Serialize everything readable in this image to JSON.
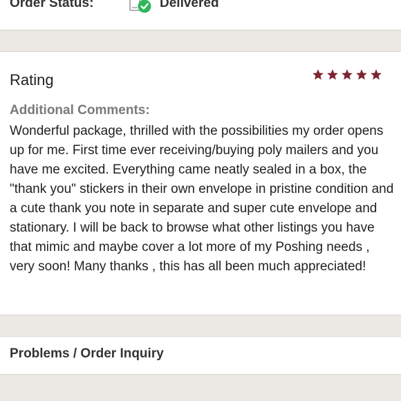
{
  "order_status": {
    "label": "Order Status:",
    "value": "Delivered",
    "icon": "package-delivered-check-icon",
    "check_color": "#2fb65a"
  },
  "rating": {
    "title": "Rating",
    "stars": 5,
    "max_stars": 5,
    "star_color": "#7d2630",
    "comments_heading": "Additional Comments:",
    "comments_text": "Wonderful package, thrilled with the possibilities my order opens up for me. First time ever receiving/buying poly mailers and you have me excited. Everything came neatly sealed in a box, the \"thank you\" stickers in their own envelope in pristine condition and a cute thank you note in separate and super cute envelope and stationary. I will be back to browse what other listings you have that mimic and maybe cover a lot more of my Poshing needs , very soon! Many thanks , this has all been much appreciated!"
  },
  "problems": {
    "label": "Problems / Order Inquiry"
  }
}
